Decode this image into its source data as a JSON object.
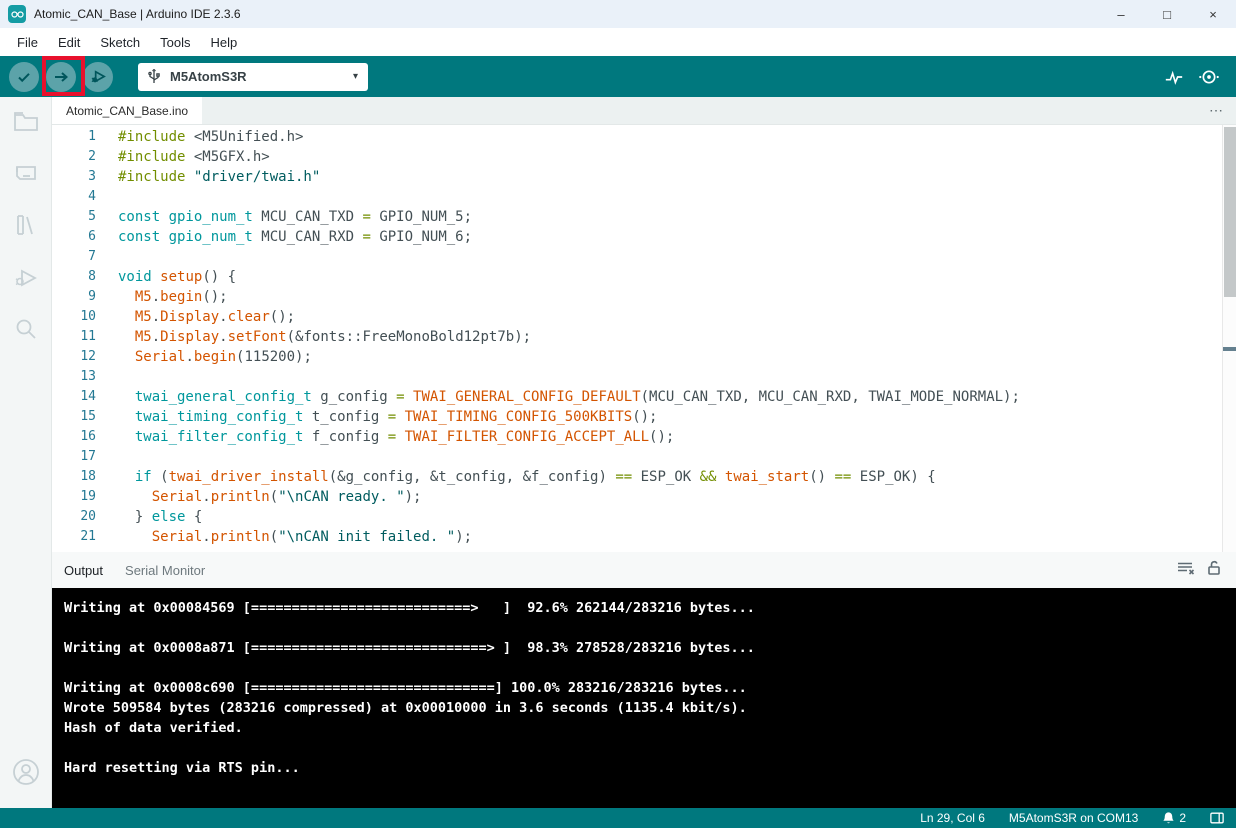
{
  "window": {
    "title": "Atomic_CAN_Base | Arduino IDE 2.3.6",
    "controls": {
      "minimize": "–",
      "maximize": "□",
      "close": "×"
    }
  },
  "colors": {
    "toolbar_teal": "#00787E",
    "button_circle_teal": "#5CA3A9",
    "annotation_red": "#E8112D",
    "console_bg": "#000000",
    "console_text": "#FFFFFF",
    "token_keyword": "#00979C",
    "token_preprocessor_operator": "#728E00",
    "token_function": "#D35400",
    "token_string": "#005C5F",
    "token_plain": "#434F54",
    "line_number": "#237893"
  },
  "menu": {
    "items": [
      "File",
      "Edit",
      "Sketch",
      "Tools",
      "Help"
    ]
  },
  "toolbar": {
    "verify_icon": "check-circle",
    "upload_icon": "arrow-right-circle",
    "debug_icon": "debug-circle",
    "board_selector": {
      "label": "M5AtomS3R",
      "usb_icon": "usb-icon",
      "caret": "▾"
    },
    "right_icons": [
      "serial-plotter-icon",
      "serial-monitor-icon"
    ]
  },
  "sidebar": {
    "items": [
      "sketchbook-folder",
      "boards-manager",
      "library-manager",
      "debug",
      "search"
    ],
    "account": "account"
  },
  "editor": {
    "tab": "Atomic_CAN_Base.ino",
    "overflow": "⋯",
    "lines": [
      {
        "n": "1",
        "s": [
          {
            "c": "pre",
            "t": "#include "
          },
          {
            "c": "pln",
            "t": "<M5Unified.h>"
          }
        ]
      },
      {
        "n": "2",
        "s": [
          {
            "c": "pre",
            "t": "#include "
          },
          {
            "c": "pln",
            "t": "<M5GFX.h>"
          }
        ]
      },
      {
        "n": "3",
        "s": [
          {
            "c": "pre",
            "t": "#include "
          },
          {
            "c": "str",
            "t": "\"driver/twai.h\""
          }
        ]
      },
      {
        "n": "4",
        "s": []
      },
      {
        "n": "5",
        "s": [
          {
            "c": "key",
            "t": "const "
          },
          {
            "c": "key",
            "t": "gpio_num_t"
          },
          {
            "c": "pln",
            "t": " MCU_CAN_TXD "
          },
          {
            "c": "pre",
            "t": "="
          },
          {
            "c": "pln",
            "t": " GPIO_NUM_5;"
          }
        ]
      },
      {
        "n": "6",
        "s": [
          {
            "c": "key",
            "t": "const "
          },
          {
            "c": "key",
            "t": "gpio_num_t"
          },
          {
            "c": "pln",
            "t": " MCU_CAN_RXD "
          },
          {
            "c": "pre",
            "t": "="
          },
          {
            "c": "pln",
            "t": " GPIO_NUM_6;"
          }
        ]
      },
      {
        "n": "7",
        "s": []
      },
      {
        "n": "8",
        "s": [
          {
            "c": "key",
            "t": "void "
          },
          {
            "c": "fn",
            "t": "setup"
          },
          {
            "c": "pln",
            "t": "() {"
          }
        ]
      },
      {
        "n": "9",
        "s": [
          {
            "c": "pln",
            "t": "  "
          },
          {
            "c": "fn",
            "t": "M5"
          },
          {
            "c": "pln",
            "t": "."
          },
          {
            "c": "fn",
            "t": "begin"
          },
          {
            "c": "pln",
            "t": "();"
          }
        ]
      },
      {
        "n": "10",
        "s": [
          {
            "c": "pln",
            "t": "  "
          },
          {
            "c": "fn",
            "t": "M5"
          },
          {
            "c": "pln",
            "t": "."
          },
          {
            "c": "fn",
            "t": "Display"
          },
          {
            "c": "pln",
            "t": "."
          },
          {
            "c": "fn",
            "t": "clear"
          },
          {
            "c": "pln",
            "t": "();"
          }
        ]
      },
      {
        "n": "11",
        "s": [
          {
            "c": "pln",
            "t": "  "
          },
          {
            "c": "fn",
            "t": "M5"
          },
          {
            "c": "pln",
            "t": "."
          },
          {
            "c": "fn",
            "t": "Display"
          },
          {
            "c": "pln",
            "t": "."
          },
          {
            "c": "fn",
            "t": "setFont"
          },
          {
            "c": "pln",
            "t": "(&fonts::FreeMonoBold12pt7b);"
          }
        ]
      },
      {
        "n": "12",
        "s": [
          {
            "c": "pln",
            "t": "  "
          },
          {
            "c": "fn",
            "t": "Serial"
          },
          {
            "c": "pln",
            "t": "."
          },
          {
            "c": "fn",
            "t": "begin"
          },
          {
            "c": "pln",
            "t": "(115200);"
          }
        ]
      },
      {
        "n": "13",
        "s": []
      },
      {
        "n": "14",
        "s": [
          {
            "c": "pln",
            "t": "  "
          },
          {
            "c": "key",
            "t": "twai_general_config_t"
          },
          {
            "c": "pln",
            "t": " g_config "
          },
          {
            "c": "pre",
            "t": "="
          },
          {
            "c": "pln",
            "t": " "
          },
          {
            "c": "fn",
            "t": "TWAI_GENERAL_CONFIG_DEFAULT"
          },
          {
            "c": "pln",
            "t": "(MCU_CAN_TXD, MCU_CAN_RXD, TWAI_MODE_NORMAL);"
          }
        ]
      },
      {
        "n": "15",
        "s": [
          {
            "c": "pln",
            "t": "  "
          },
          {
            "c": "key",
            "t": "twai_timing_config_t"
          },
          {
            "c": "pln",
            "t": " t_config "
          },
          {
            "c": "pre",
            "t": "="
          },
          {
            "c": "pln",
            "t": " "
          },
          {
            "c": "fn",
            "t": "TWAI_TIMING_CONFIG_500KBITS"
          },
          {
            "c": "pln",
            "t": "();"
          }
        ]
      },
      {
        "n": "16",
        "s": [
          {
            "c": "pln",
            "t": "  "
          },
          {
            "c": "key",
            "t": "twai_filter_config_t"
          },
          {
            "c": "pln",
            "t": " f_config "
          },
          {
            "c": "pre",
            "t": "="
          },
          {
            "c": "pln",
            "t": " "
          },
          {
            "c": "fn",
            "t": "TWAI_FILTER_CONFIG_ACCEPT_ALL"
          },
          {
            "c": "pln",
            "t": "();"
          }
        ]
      },
      {
        "n": "17",
        "s": []
      },
      {
        "n": "18",
        "s": [
          {
            "c": "pln",
            "t": "  "
          },
          {
            "c": "key",
            "t": "if"
          },
          {
            "c": "pln",
            "t": " ("
          },
          {
            "c": "fn",
            "t": "twai_driver_install"
          },
          {
            "c": "pln",
            "t": "(&g_config, &t_config, &f_config) "
          },
          {
            "c": "pre",
            "t": "=="
          },
          {
            "c": "pln",
            "t": " ESP_OK "
          },
          {
            "c": "pre",
            "t": "&&"
          },
          {
            "c": "pln",
            "t": " "
          },
          {
            "c": "fn",
            "t": "twai_start"
          },
          {
            "c": "pln",
            "t": "() "
          },
          {
            "c": "pre",
            "t": "=="
          },
          {
            "c": "pln",
            "t": " ESP_OK) {"
          }
        ]
      },
      {
        "n": "19",
        "s": [
          {
            "c": "pln",
            "t": "    "
          },
          {
            "c": "fn",
            "t": "Serial"
          },
          {
            "c": "pln",
            "t": "."
          },
          {
            "c": "fn",
            "t": "println"
          },
          {
            "c": "pln",
            "t": "("
          },
          {
            "c": "str",
            "t": "\"\\nCAN ready. \""
          },
          {
            "c": "pln",
            "t": ");"
          }
        ]
      },
      {
        "n": "20",
        "s": [
          {
            "c": "pln",
            "t": "  } "
          },
          {
            "c": "key",
            "t": "else"
          },
          {
            "c": "pln",
            "t": " {"
          }
        ]
      },
      {
        "n": "21",
        "s": [
          {
            "c": "pln",
            "t": "    "
          },
          {
            "c": "fn",
            "t": "Serial"
          },
          {
            "c": "pln",
            "t": "."
          },
          {
            "c": "fn",
            "t": "println"
          },
          {
            "c": "pln",
            "t": "("
          },
          {
            "c": "str",
            "t": "\"\\nCAN init failed. \""
          },
          {
            "c": "pln",
            "t": ");"
          }
        ]
      }
    ]
  },
  "output_panel": {
    "tabs": {
      "output": "Output",
      "serial_monitor": "Serial Monitor"
    },
    "icons": [
      "clear-output-icon",
      "lock-open-icon"
    ]
  },
  "console": {
    "lines": [
      "Writing at 0x00084569 [===========================>   ]  92.6% 262144/283216 bytes...",
      "",
      "Writing at 0x0008a871 [=============================> ]  98.3% 278528/283216 bytes...",
      "",
      "Writing at 0x0008c690 [==============================] 100.0% 283216/283216 bytes...",
      "Wrote 509584 bytes (283216 compressed) at 0x00010000 in 3.6 seconds (1135.4 kbit/s).",
      "Hash of data verified.",
      "",
      "Hard resetting via RTS pin..."
    ]
  },
  "statusbar": {
    "cursor_position": "Ln 29, Col 6",
    "board_port": "M5AtomS3R on COM13",
    "notification_count": "2"
  }
}
